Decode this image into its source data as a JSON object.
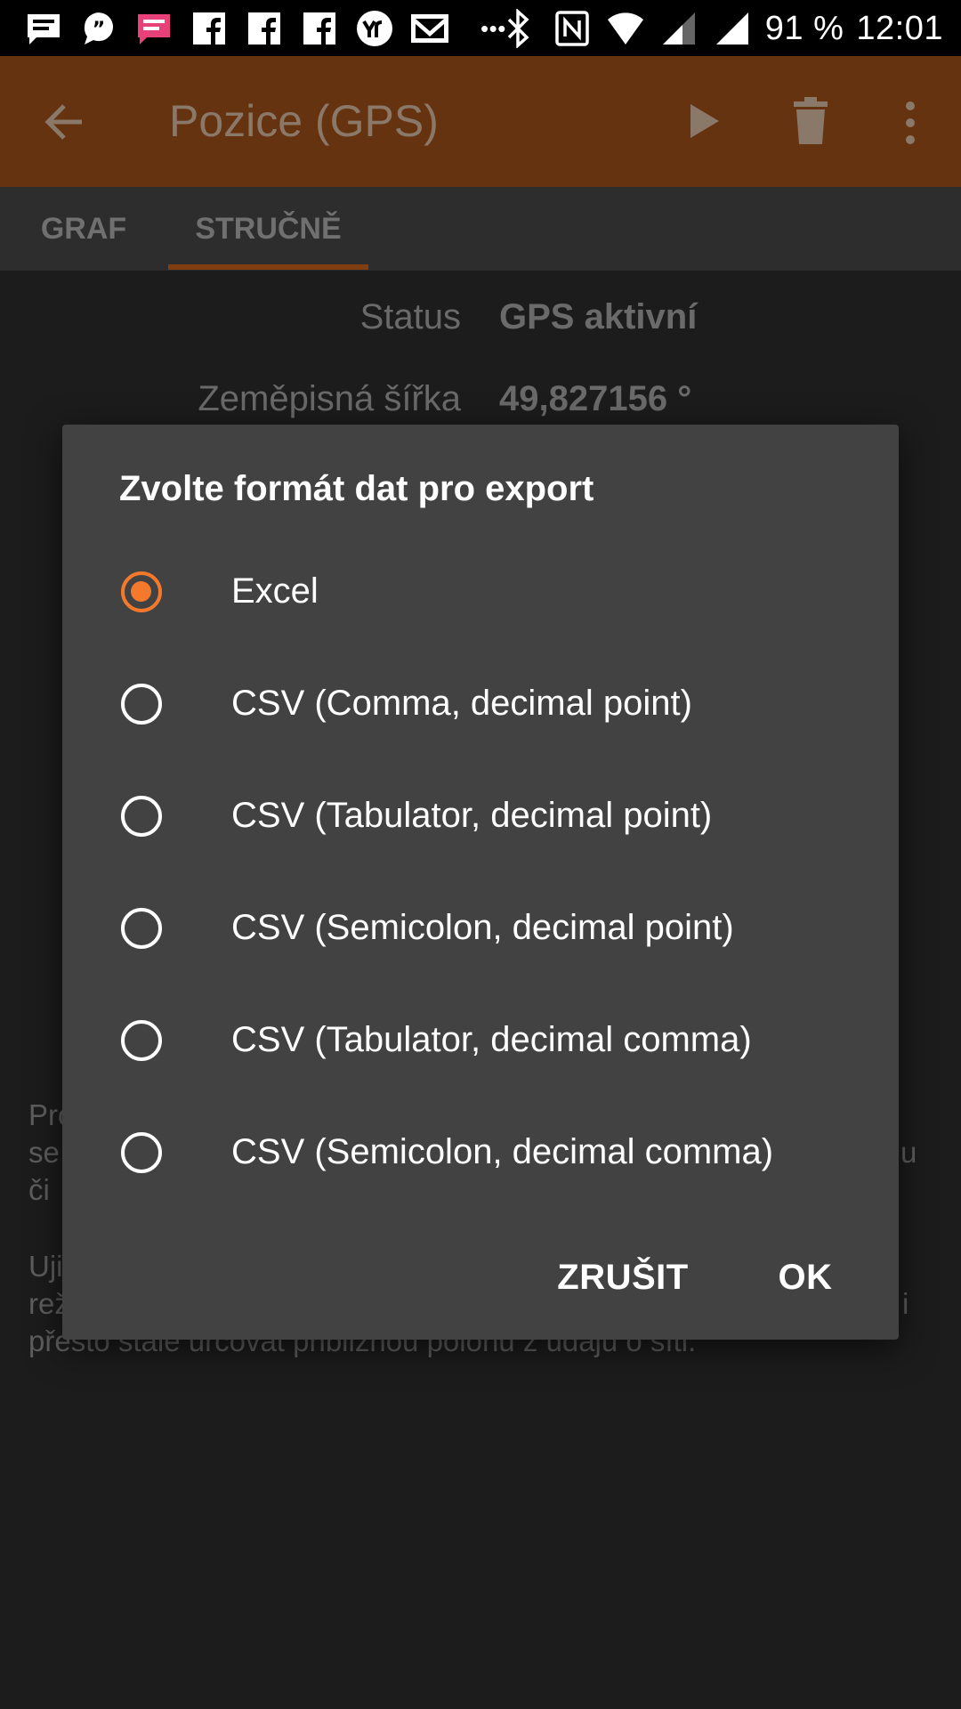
{
  "status_bar": {
    "battery": "91 %",
    "time": "12:01",
    "more_indicator": "•••",
    "left_icons": [
      "message-icon",
      "quote-icon",
      "message-pink-icon",
      "facebook-icon",
      "facebook-icon",
      "facebook-icon",
      "yr-icon",
      "mail-icon"
    ],
    "right_icons": [
      "bluetooth-icon",
      "nfc-icon",
      "wifi-icon",
      "signal-icon",
      "signal-icon"
    ],
    "accent_pink": "#e8417a"
  },
  "app_bar": {
    "title": "Pozice (GPS)",
    "background": "#663310"
  },
  "tabs": [
    {
      "label": "GRAF",
      "selected": false
    },
    {
      "label": "STRUČNĚ",
      "selected": true
    }
  ],
  "summary": {
    "rows": [
      {
        "label": "Status",
        "value": "GPS aktivní"
      },
      {
        "label": "Zeměpisná šířka",
        "value": "49,827156 °"
      }
    ],
    "para1": {
      "line1_left": "Pro",
      "line1_right": "",
      "line2_left": "se",
      "line2_right": "u",
      "line3_left": "či"
    },
    "para2": {
      "line1_left": "Uji",
      "line2_left": "rež",
      "line2_right": "i",
      "line3": "přesto stále určovat přibližnou polohu z údajů o síti."
    }
  },
  "dialog": {
    "title": "Zvolte formát dat pro export",
    "options": [
      {
        "label": "Excel",
        "selected": true
      },
      {
        "label": "CSV (Comma, decimal point)",
        "selected": false
      },
      {
        "label": "CSV (Tabulator, decimal point)",
        "selected": false
      },
      {
        "label": "CSV (Semicolon, decimal point)",
        "selected": false
      },
      {
        "label": "CSV (Tabulator, decimal comma)",
        "selected": false
      },
      {
        "label": "CSV (Semicolon, decimal comma)",
        "selected": false
      }
    ],
    "cancel_label": "ZRUŠIT",
    "ok_label": "OK",
    "accent": "#f5792c"
  }
}
